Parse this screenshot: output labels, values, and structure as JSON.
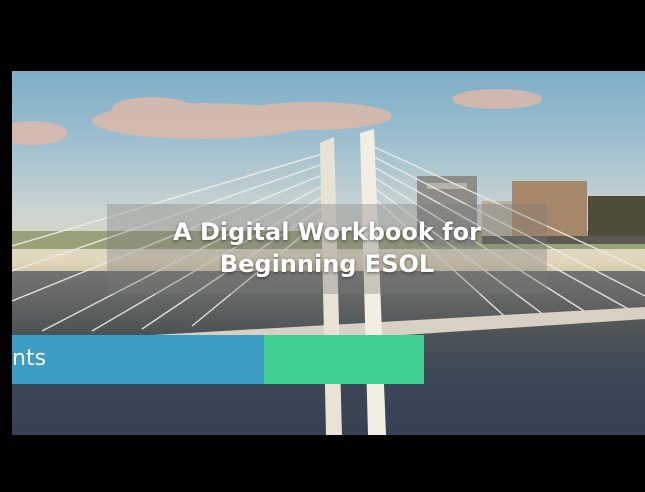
{
  "video": {
    "title_line1": "A Digital Workbook for",
    "title_line2": "Beginning ESOL",
    "lower_third_text": "nts",
    "colors": {
      "letterbox": "#000000",
      "lower_third_blue": "#3b9cc4",
      "lower_third_green": "#3fcf90",
      "title_text": "#ffffff"
    }
  }
}
